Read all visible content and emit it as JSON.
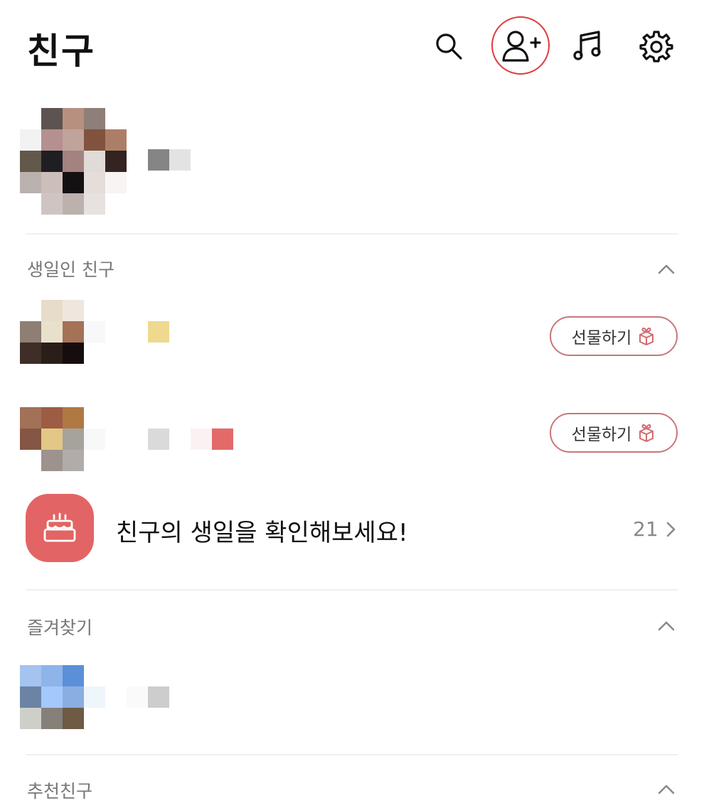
{
  "header": {
    "title": "친구",
    "icons": [
      "search-icon",
      "add-friend-icon",
      "music-icon",
      "settings-icon"
    ]
  },
  "sections": {
    "birthday": {
      "label": "생일인 친구",
      "gift_label": "선물하기",
      "banner_text": "친구의 생일을 확인해보세요!",
      "count": "21"
    },
    "favorites": {
      "label": "즐겨찾기"
    },
    "recommended": {
      "label": "추천친구"
    }
  },
  "colors": {
    "highlight": "#e03b3b",
    "gift_border": "#c9767b",
    "birthday_icon_bg": "#e36464"
  }
}
